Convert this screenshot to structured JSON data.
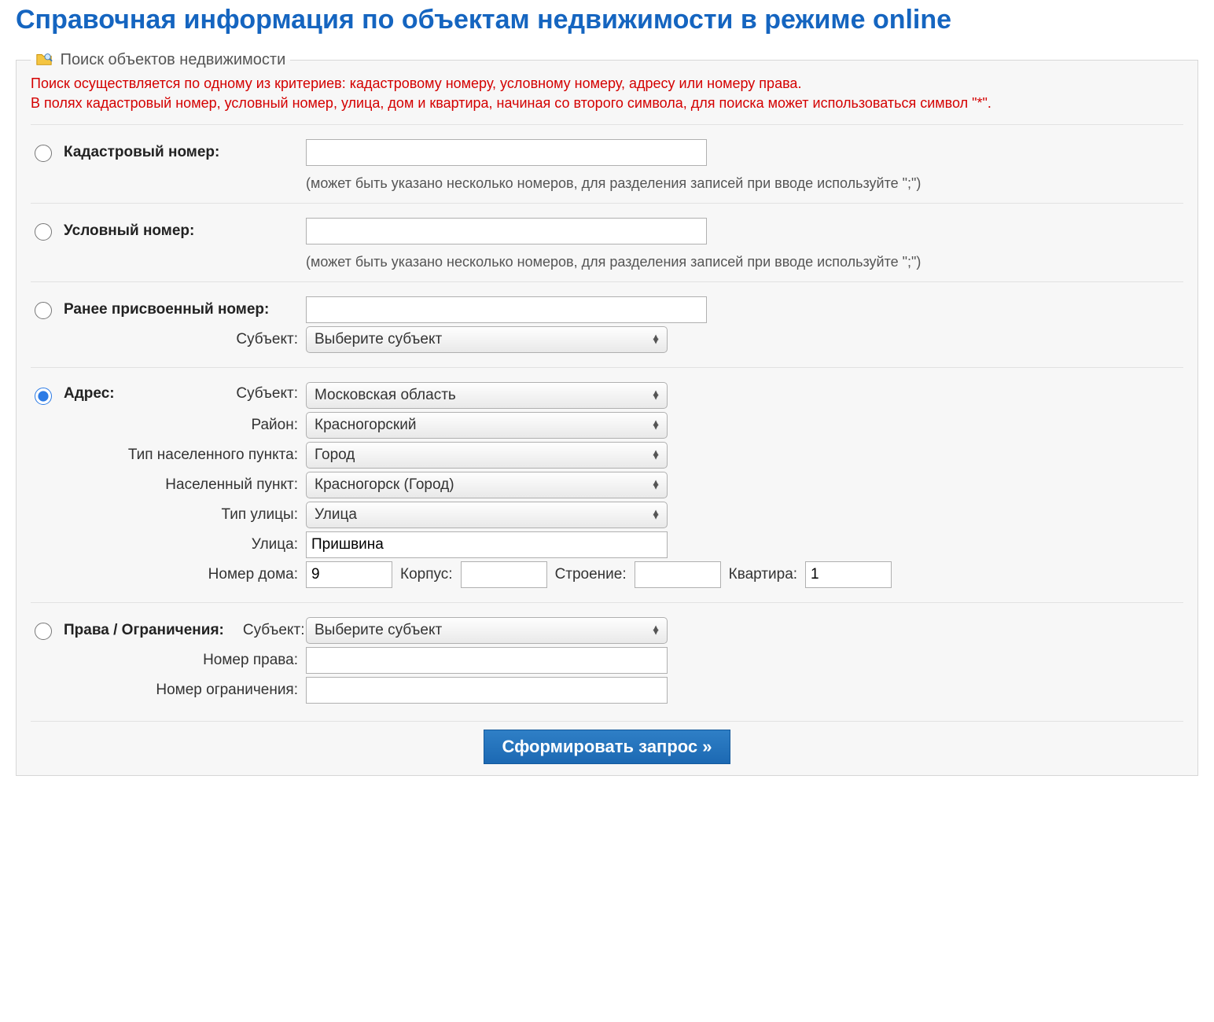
{
  "title": "Справочная информация по объектам недвижимости в режиме online",
  "legend": "Поиск объектов недвижимости",
  "hint_line1": "Поиск осуществляется по одному из критериев: кадастровому номеру, условному номеру, адресу или номеру права.",
  "hint_line2": "В полях кадастровый номер, условный номер, улица, дом и квартира, начиная со второго символа, для поиска может использоваться символ \"*\".",
  "criteria": {
    "cadastral": {
      "label": "Кадастровый номер:",
      "value": "",
      "note": "(может быть указано несколько номеров, для разделения записей при вводе используйте \";\")"
    },
    "conditional": {
      "label": "Условный номер:",
      "value": "",
      "note": "(может быть указано несколько номеров, для разделения записей при вводе используйте \";\")"
    },
    "previous": {
      "label": "Ранее присвоенный номер:",
      "value": "",
      "subject_label": "Субъект:",
      "subject_value": "Выберите субъект"
    },
    "address": {
      "label": "Адрес:",
      "subject_label": "Субъект:",
      "subject_value": "Московская область",
      "district_label": "Район:",
      "district_value": "Красногорский",
      "settlement_type_label": "Тип населенного пункта:",
      "settlement_type_value": "Город",
      "settlement_label": "Населенный пункт:",
      "settlement_value": "Красногорск (Город)",
      "street_type_label": "Тип улицы:",
      "street_type_value": "Улица",
      "street_label": "Улица:",
      "street_value": "Пришвина",
      "house_label": "Номер дома:",
      "house_value": "9",
      "korpus_label": "Корпус:",
      "korpus_value": "",
      "building_label": "Строение:",
      "building_value": "",
      "flat_label": "Квартира:",
      "flat_value": "1"
    },
    "rights": {
      "label": "Права / Ограничения:",
      "subject_label": "Субъект:",
      "subject_value": "Выберите субъект",
      "right_no_label": "Номер права:",
      "right_no_value": "",
      "restriction_no_label": "Номер ограничения:",
      "restriction_no_value": ""
    }
  },
  "submit_label": "Сформировать запрос »"
}
